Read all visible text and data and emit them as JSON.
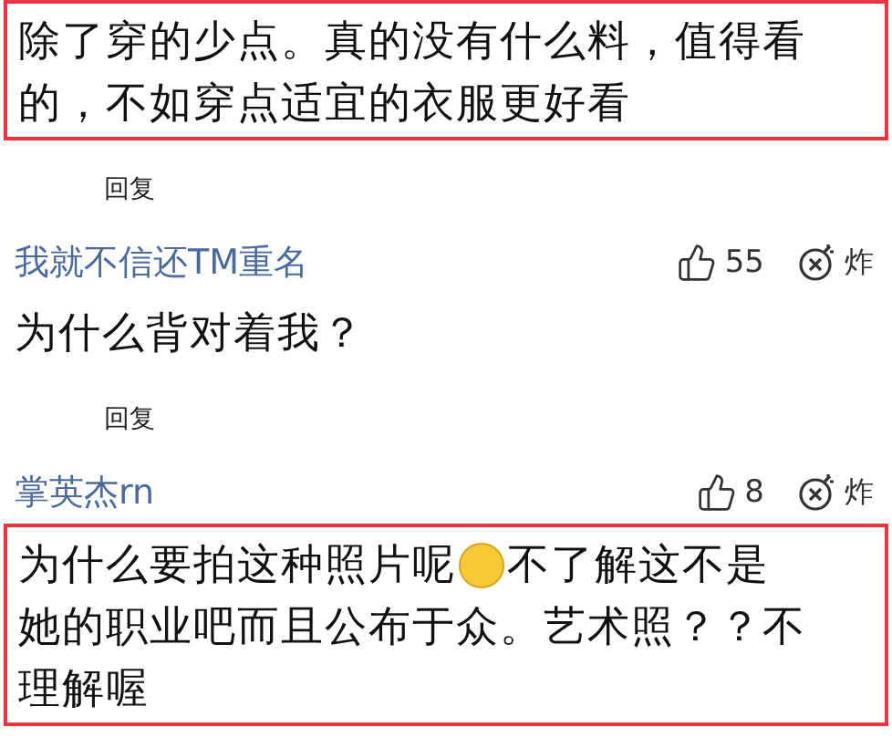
{
  "comments": [
    {
      "highlighted": true,
      "lines": [
        [
          {
            "kind": "text",
            "text": "除了穿的少点。真的没有什么料，值得看"
          }
        ],
        [
          {
            "kind": "text",
            "text": "的，不如穿点适宜的衣服更好看"
          }
        ]
      ],
      "reply": "回复"
    },
    {
      "author": "我就不信还TM重名",
      "likes": "55",
      "bomb": "炸",
      "highlighted": false,
      "lines": [
        [
          {
            "kind": "text",
            "text": "为什么背对着我？"
          }
        ]
      ],
      "reply": "回复"
    },
    {
      "author": "掌英杰rn",
      "likes": "8",
      "bomb": "炸",
      "highlighted": true,
      "lines": [
        [
          {
            "kind": "text",
            "text": "为什么要拍这种照片呢"
          },
          {
            "kind": "emoji"
          },
          {
            "kind": "text",
            "text": "不了解这不是"
          }
        ],
        [
          {
            "kind": "text",
            "text": "她的职业吧而且公布于众。艺术照？？不"
          }
        ],
        [
          {
            "kind": "text",
            "text": "理解喔"
          }
        ]
      ]
    }
  ]
}
